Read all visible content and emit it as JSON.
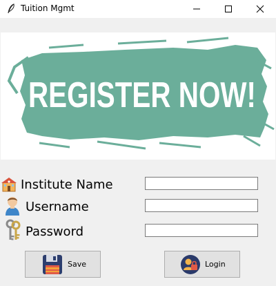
{
  "window": {
    "title": "Tuition Mgmt",
    "controls": [
      "minimize",
      "maximize",
      "close"
    ]
  },
  "banner": {
    "text": "REGISTER NOW!",
    "brush_color": "#6bae9a",
    "text_color": "#ffffff"
  },
  "form": {
    "fields": [
      {
        "label": "Institute Name",
        "icon": "school-building-icon",
        "value": ""
      },
      {
        "label": "Username",
        "icon": "user-avatar-icon",
        "value": ""
      },
      {
        "label": "Password",
        "icon": "keys-icon",
        "value": ""
      }
    ]
  },
  "buttons": {
    "save_label": "Save",
    "login_label": "Login",
    "save_icon": "floppy-disk-icon",
    "login_icon": "user-lock-icon"
  }
}
